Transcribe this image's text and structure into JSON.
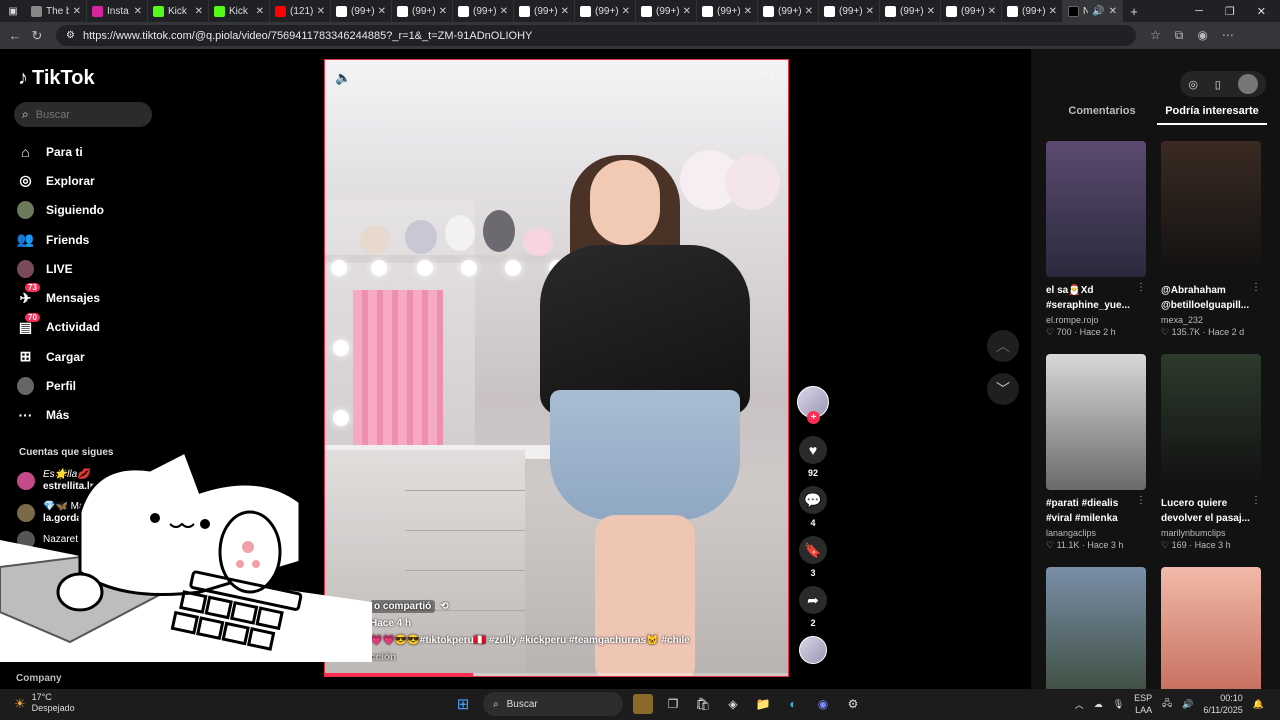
{
  "browser": {
    "tabs": [
      {
        "title": "The b",
        "color": "#888"
      },
      {
        "title": "Insta",
        "color": "#d6249f"
      },
      {
        "title": "Kick",
        "color": "#53fc18"
      },
      {
        "title": "Kick",
        "color": "#53fc18"
      },
      {
        "title": "(121)",
        "color": "#ff0000"
      },
      {
        "title": "(99+)",
        "color": "#fff"
      },
      {
        "title": "(99+)",
        "color": "#fff"
      },
      {
        "title": "(99+)",
        "color": "#fff"
      },
      {
        "title": "(99+)",
        "color": "#fff"
      },
      {
        "title": "(99+)",
        "color": "#fff"
      },
      {
        "title": "(99+)",
        "color": "#fff"
      },
      {
        "title": "(99+)",
        "color": "#fff"
      },
      {
        "title": "(99+)",
        "color": "#fff"
      },
      {
        "title": "(99+)",
        "color": "#fff"
      },
      {
        "title": "(99+)",
        "color": "#fff"
      },
      {
        "title": "(99+)",
        "color": "#fff"
      },
      {
        "title": "(99+)",
        "color": "#fff"
      }
    ],
    "active_tab": "N",
    "url": "https://www.tiktok.com/@q.piola/video/7569411783346244885?_r=1&_t=ZM-91ADnOLIOHY"
  },
  "sidebar": {
    "logo": "TikTok",
    "search_placeholder": "Buscar",
    "items": [
      {
        "label": "Para ti",
        "icon": "home-icon"
      },
      {
        "label": "Explorar",
        "icon": "compass-icon"
      },
      {
        "label": "Siguiendo",
        "icon": "avatar"
      },
      {
        "label": "Friends",
        "icon": "friends-icon"
      },
      {
        "label": "LIVE",
        "icon": "avatar"
      },
      {
        "label": "Mensajes",
        "icon": "message-icon",
        "badge": "73"
      },
      {
        "label": "Actividad",
        "icon": "activity-icon",
        "badge": "70"
      },
      {
        "label": "Cargar",
        "icon": "upload-icon"
      },
      {
        "label": "Perfil",
        "icon": "avatar"
      },
      {
        "label": "Más",
        "icon": "more-icon"
      }
    ],
    "following_title": "Cuentas que sigues",
    "following": [
      {
        "name": "Es🌟lla💋",
        "handle": "estrellita.lm19"
      },
      {
        "name": "💎🦋 Mariam",
        "handle": "la.gorda.bel"
      },
      {
        "name": "Nazareth",
        "handle": ""
      }
    ],
    "company": "Company"
  },
  "video": {
    "shared_label": "o compartió",
    "time_ago": "Hace 4 h",
    "caption": "💗💗😎😎#tiktokperu🇵🇪 #zully #kickperu #teamgachurras🐱 #chile",
    "caption_more": "cción",
    "progress": 0.32
  },
  "actions": {
    "likes": "92",
    "comments": "4",
    "saves": "3",
    "shares": "2"
  },
  "right_panel": {
    "tabs": [
      "Comentarios",
      "Podría interesarte"
    ],
    "cards": [
      {
        "title1": "el sa🎅Xd",
        "title2": "#seraphine_yue...",
        "user": "el.rompe.rojo",
        "meta": "♡ 700 · Hace 2 h",
        "c1": "#5c4a70",
        "c2": "#2a2a3c"
      },
      {
        "title1": "@Abrahaham",
        "title2": "@betilloelguapill...",
        "user": "mexa_232",
        "meta": "♡ 135.7K · Hace 2 d",
        "c1": "#3a2a22",
        "c2": "#111"
      },
      {
        "title1": "#parati #diealis",
        "title2": "#viral #milenka",
        "user": "lanangaclips",
        "meta": "♡ 11.1K · Hace 3 h",
        "c1": "#d8d8d8",
        "c2": "#6a6a6a"
      },
      {
        "title1": "Lucero quiere",
        "title2": "devolver el pasaj...",
        "user": "marilynbumclips",
        "meta": "♡ 169 · Hace 3 h",
        "c1": "#2c3a2c",
        "c2": "#111"
      },
      {
        "title1": "",
        "title2": "",
        "user": "",
        "meta": "",
        "c1": "#7a8fa8",
        "c2": "#3a4a3a"
      },
      {
        "title1": "",
        "title2": "",
        "user": "",
        "meta": "",
        "c1": "#f1b9a8",
        "c2": "#c46a5a"
      }
    ]
  },
  "taskbar": {
    "temp": "17°C",
    "weather": "Despejado",
    "search": "Buscar",
    "lang1": "ESP",
    "lang2": "LAA",
    "time": "00:10",
    "date": "6/11/2025"
  }
}
